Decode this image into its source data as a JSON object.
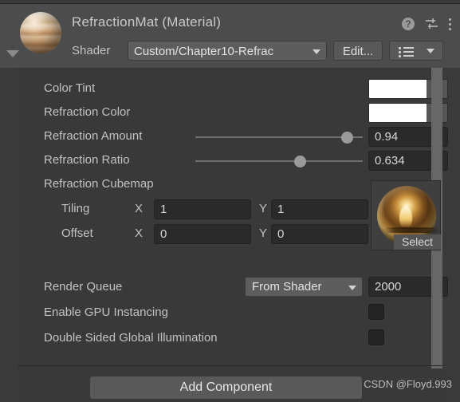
{
  "window": {
    "title": "RefractionMat (Material)"
  },
  "header": {
    "shader_label": "Shader",
    "shader_value": "Custom/Chapter10-Refrac",
    "edit_label": "Edit...",
    "icons": {
      "help": "?",
      "preset": "preset-icon",
      "menu": "kebab-menu-icon",
      "list": "shader-list-icon"
    },
    "foldout": "foldout-arrow-icon",
    "preview": "material-preview-sphere"
  },
  "properties": {
    "color_tint": {
      "label": "Color Tint",
      "color": "#ffffff",
      "eyedropper": "eyedropper-icon"
    },
    "refraction_color": {
      "label": "Refraction Color",
      "color": "#ffffff",
      "eyedropper": "eyedropper-icon"
    },
    "refraction_amount": {
      "label": "Refraction Amount",
      "value": "0.94",
      "slider_fraction": 0.94
    },
    "refraction_ratio": {
      "label": "Refraction Ratio",
      "value": "0.634",
      "slider_fraction": 0.634
    },
    "refraction_cubemap": {
      "label": "Refraction Cubemap",
      "select_label": "Select",
      "thumbnail": "cubemap-preview-sphere"
    },
    "tiling": {
      "label": "Tiling",
      "x_axis": "X",
      "y_axis": "Y",
      "x": "1",
      "y": "1"
    },
    "offset": {
      "label": "Offset",
      "x_axis": "X",
      "y_axis": "Y",
      "x": "0",
      "y": "0"
    }
  },
  "render_settings": {
    "render_queue": {
      "label": "Render Queue",
      "mode": "From Shader",
      "value": "2000"
    },
    "gpu_instancing": {
      "label": "Enable GPU Instancing",
      "checked": false
    },
    "double_sided_gi": {
      "label": "Double Sided Global Illumination",
      "checked": false
    }
  },
  "footer": {
    "add_component_label": "Add Component",
    "watermark": "CSDN @Floyd.993"
  },
  "colors": {
    "panel_bg": "#393939",
    "header_bg": "#4c4c4c",
    "field_bg": "#2a2a2a",
    "button_bg": "#585858",
    "text": "#c2c2c2",
    "scrollbar": "#676767"
  }
}
